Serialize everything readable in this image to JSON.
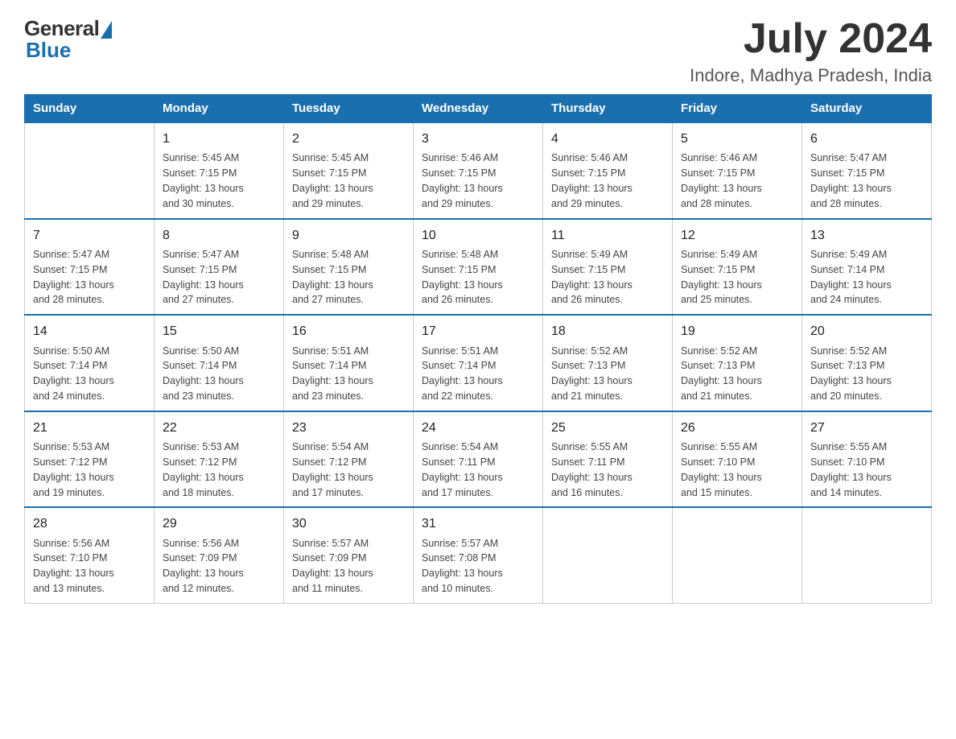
{
  "header": {
    "logo_general": "General",
    "logo_blue": "Blue",
    "month_title": "July 2024",
    "location": "Indore, Madhya Pradesh, India"
  },
  "days_of_week": [
    "Sunday",
    "Monday",
    "Tuesday",
    "Wednesday",
    "Thursday",
    "Friday",
    "Saturday"
  ],
  "weeks": [
    [
      {
        "day": "",
        "info": ""
      },
      {
        "day": "1",
        "info": "Sunrise: 5:45 AM\nSunset: 7:15 PM\nDaylight: 13 hours\nand 30 minutes."
      },
      {
        "day": "2",
        "info": "Sunrise: 5:45 AM\nSunset: 7:15 PM\nDaylight: 13 hours\nand 29 minutes."
      },
      {
        "day": "3",
        "info": "Sunrise: 5:46 AM\nSunset: 7:15 PM\nDaylight: 13 hours\nand 29 minutes."
      },
      {
        "day": "4",
        "info": "Sunrise: 5:46 AM\nSunset: 7:15 PM\nDaylight: 13 hours\nand 29 minutes."
      },
      {
        "day": "5",
        "info": "Sunrise: 5:46 AM\nSunset: 7:15 PM\nDaylight: 13 hours\nand 28 minutes."
      },
      {
        "day": "6",
        "info": "Sunrise: 5:47 AM\nSunset: 7:15 PM\nDaylight: 13 hours\nand 28 minutes."
      }
    ],
    [
      {
        "day": "7",
        "info": "Sunrise: 5:47 AM\nSunset: 7:15 PM\nDaylight: 13 hours\nand 28 minutes."
      },
      {
        "day": "8",
        "info": "Sunrise: 5:47 AM\nSunset: 7:15 PM\nDaylight: 13 hours\nand 27 minutes."
      },
      {
        "day": "9",
        "info": "Sunrise: 5:48 AM\nSunset: 7:15 PM\nDaylight: 13 hours\nand 27 minutes."
      },
      {
        "day": "10",
        "info": "Sunrise: 5:48 AM\nSunset: 7:15 PM\nDaylight: 13 hours\nand 26 minutes."
      },
      {
        "day": "11",
        "info": "Sunrise: 5:49 AM\nSunset: 7:15 PM\nDaylight: 13 hours\nand 26 minutes."
      },
      {
        "day": "12",
        "info": "Sunrise: 5:49 AM\nSunset: 7:15 PM\nDaylight: 13 hours\nand 25 minutes."
      },
      {
        "day": "13",
        "info": "Sunrise: 5:49 AM\nSunset: 7:14 PM\nDaylight: 13 hours\nand 24 minutes."
      }
    ],
    [
      {
        "day": "14",
        "info": "Sunrise: 5:50 AM\nSunset: 7:14 PM\nDaylight: 13 hours\nand 24 minutes."
      },
      {
        "day": "15",
        "info": "Sunrise: 5:50 AM\nSunset: 7:14 PM\nDaylight: 13 hours\nand 23 minutes."
      },
      {
        "day": "16",
        "info": "Sunrise: 5:51 AM\nSunset: 7:14 PM\nDaylight: 13 hours\nand 23 minutes."
      },
      {
        "day": "17",
        "info": "Sunrise: 5:51 AM\nSunset: 7:14 PM\nDaylight: 13 hours\nand 22 minutes."
      },
      {
        "day": "18",
        "info": "Sunrise: 5:52 AM\nSunset: 7:13 PM\nDaylight: 13 hours\nand 21 minutes."
      },
      {
        "day": "19",
        "info": "Sunrise: 5:52 AM\nSunset: 7:13 PM\nDaylight: 13 hours\nand 21 minutes."
      },
      {
        "day": "20",
        "info": "Sunrise: 5:52 AM\nSunset: 7:13 PM\nDaylight: 13 hours\nand 20 minutes."
      }
    ],
    [
      {
        "day": "21",
        "info": "Sunrise: 5:53 AM\nSunset: 7:12 PM\nDaylight: 13 hours\nand 19 minutes."
      },
      {
        "day": "22",
        "info": "Sunrise: 5:53 AM\nSunset: 7:12 PM\nDaylight: 13 hours\nand 18 minutes."
      },
      {
        "day": "23",
        "info": "Sunrise: 5:54 AM\nSunset: 7:12 PM\nDaylight: 13 hours\nand 17 minutes."
      },
      {
        "day": "24",
        "info": "Sunrise: 5:54 AM\nSunset: 7:11 PM\nDaylight: 13 hours\nand 17 minutes."
      },
      {
        "day": "25",
        "info": "Sunrise: 5:55 AM\nSunset: 7:11 PM\nDaylight: 13 hours\nand 16 minutes."
      },
      {
        "day": "26",
        "info": "Sunrise: 5:55 AM\nSunset: 7:10 PM\nDaylight: 13 hours\nand 15 minutes."
      },
      {
        "day": "27",
        "info": "Sunrise: 5:55 AM\nSunset: 7:10 PM\nDaylight: 13 hours\nand 14 minutes."
      }
    ],
    [
      {
        "day": "28",
        "info": "Sunrise: 5:56 AM\nSunset: 7:10 PM\nDaylight: 13 hours\nand 13 minutes."
      },
      {
        "day": "29",
        "info": "Sunrise: 5:56 AM\nSunset: 7:09 PM\nDaylight: 13 hours\nand 12 minutes."
      },
      {
        "day": "30",
        "info": "Sunrise: 5:57 AM\nSunset: 7:09 PM\nDaylight: 13 hours\nand 11 minutes."
      },
      {
        "day": "31",
        "info": "Sunrise: 5:57 AM\nSunset: 7:08 PM\nDaylight: 13 hours\nand 10 minutes."
      },
      {
        "day": "",
        "info": ""
      },
      {
        "day": "",
        "info": ""
      },
      {
        "day": "",
        "info": ""
      }
    ]
  ]
}
